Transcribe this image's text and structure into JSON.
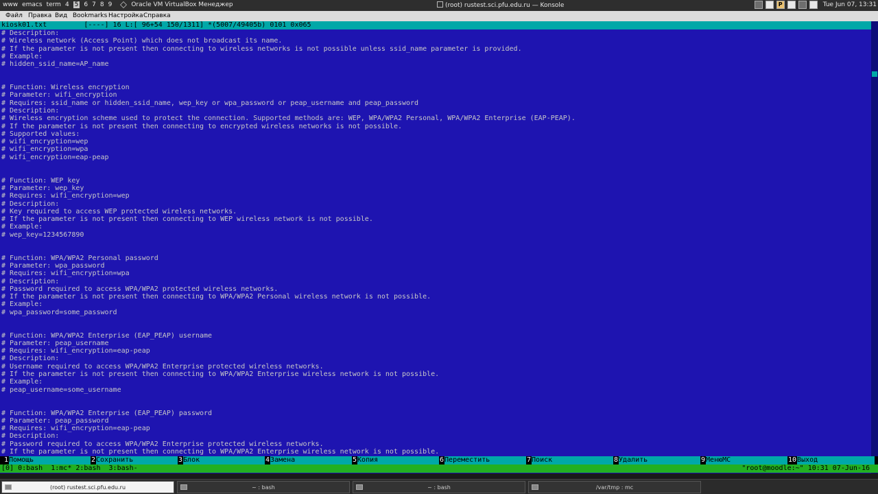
{
  "topbar": {
    "launcher_items": [
      "www",
      "emacs",
      "term"
    ],
    "desktops": [
      "4",
      "5",
      "6",
      "7",
      "8",
      "9"
    ],
    "active_desktop": "5",
    "vbox_label": "Oracle VM VirtualBox Менеджер",
    "window_title": "(root) rustest.sci.pfu.edu.ru — Konsole",
    "tray_p": "P",
    "clock": "Tue Jun 07, 13:31"
  },
  "menubar": {
    "items": [
      "Файл",
      "Правка",
      "Вид",
      "Bookmarks",
      "Настройка",
      "Справка"
    ]
  },
  "editor": {
    "status_line": "kiosk01.txt         [----] 16 L:[ 96+54 150/1311] *(5007/49405b) 0101 0x065",
    "lines": [
      "# Description:",
      "# Wireless network (Access Point) which does not broadcast its name.",
      "# If the parameter is not present then connecting to wireless networks is not possible unless ssid_name parameter is provided.",
      "# Example:",
      "# hidden_ssid_name=AP_name",
      "",
      "",
      "# Function: Wireless encryption",
      "# Parameter: wifi_encryption",
      "# Requires: ssid_name or hidden_ssid_name, wep_key or wpa_password or peap_username and peap_password",
      "# Description:",
      "# Wireless encryption scheme used to protect the connection. Supported methods are: WEP, WPA/WPA2 Personal, WPA/WPA2 Enterprise (EAP-PEAP).",
      "# If the parameter is not present then connecting to encrypted wireless networks is not possible.",
      "# Supported values:",
      "# wifi_encryption=wep",
      "# wifi_encryption=wpa",
      "# wifi_encryption=eap-peap",
      "",
      "",
      "# Function: WEP key",
      "# Parameter: wep_key",
      "# Requires: wifi_encryption=wep",
      "# Description:",
      "# Key required to access WEP protected wireless networks.",
      "# If the parameter is not present then connecting to WEP wireless network is not possible.",
      "# Example:",
      "# wep_key=1234567890",
      "",
      "",
      "# Function: WPA/WPA2 Personal password",
      "# Parameter: wpa_password",
      "# Requires: wifi_encryption=wpa",
      "# Description:",
      "# Password required to access WPA/WPA2 protected wireless networks.",
      "# If the parameter is not present then connecting to WPA/WPA2 Personal wireless network is not possible.",
      "# Example:",
      "# wpa_password=some_password",
      "",
      "",
      "# Function: WPA/WPA2 Enterprise (EAP_PEAP) username",
      "# Parameter: peap_username",
      "# Requires: wifi_encryption=eap-peap",
      "# Description:",
      "# Username required to access WPA/WPA2 Enterprise protected wireless networks.",
      "# If the parameter is not present then connecting to WPA/WPA2 Enterprise wireless network is not possible.",
      "# Example:",
      "# peap_username=some_username",
      "",
      "",
      "# Function: WPA/WPA2 Enterprise (EAP_PEAP) password",
      "# Parameter: peap_password",
      "# Requires: wifi_encryption=eap-peap",
      "# Description:",
      "# Password required to access WPA/WPA2 Enterprise protected wireless networks.",
      "# If the parameter is not present then connecting to WPA/WPA2 Enterprise wireless network is not possible."
    ],
    "cursor_line_index": 55,
    "cursor_col": 20,
    "scroll_fraction": 0.114
  },
  "fkeys": [
    {
      "num": "1",
      "label": "Помощь"
    },
    {
      "num": "2",
      "label": "Сохранить"
    },
    {
      "num": "3",
      "label": "Блок"
    },
    {
      "num": "4",
      "label": "Замена"
    },
    {
      "num": "5",
      "label": "Копия"
    },
    {
      "num": "6",
      "label": "Переместить"
    },
    {
      "num": "7",
      "label": "Поиск"
    },
    {
      "num": "8",
      "label": "Удалить"
    },
    {
      "num": "9",
      "label": "МенюMC"
    },
    {
      "num": "10",
      "label": "Выход"
    }
  ],
  "tmux": {
    "windows": "[0] 0:bash  1:mc* 2:bash  3:bash-",
    "right": "\"root@moodle:~\" 10:31 07-Jun-16"
  },
  "taskbar": {
    "tasks": [
      {
        "label": "(root) rustest.sci.pfu.edu.ru",
        "active": true
      },
      {
        "label": "~ : bash",
        "active": false
      },
      {
        "label": "~ : bash",
        "active": false
      },
      {
        "label": "/var/tmp : mc",
        "active": false
      }
    ]
  }
}
